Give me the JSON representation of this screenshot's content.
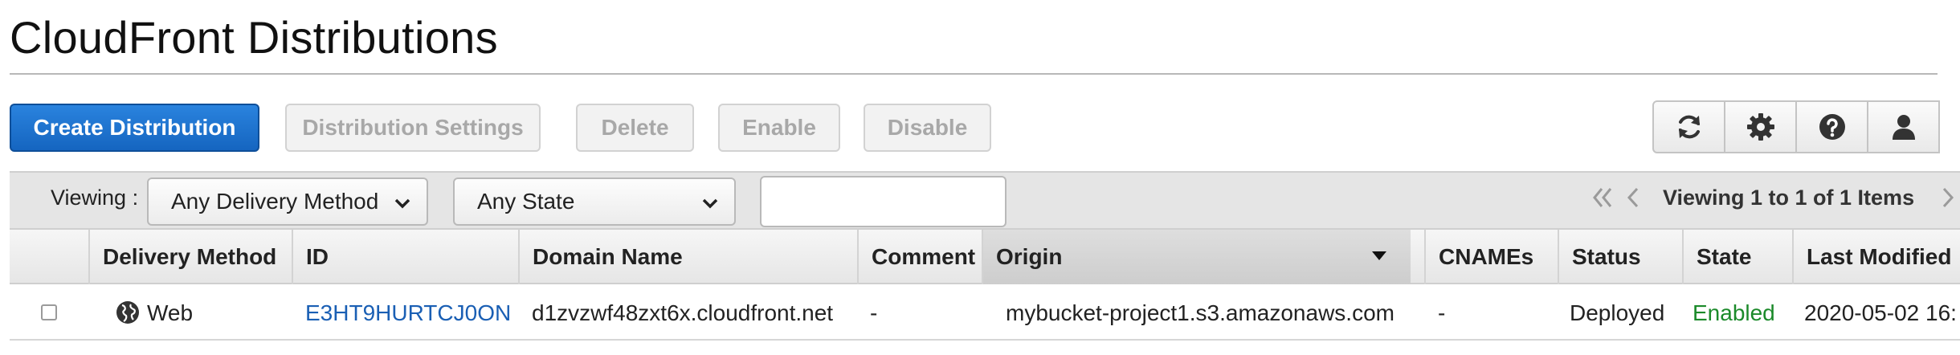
{
  "page": {
    "title": "CloudFront Distributions"
  },
  "actions": {
    "create": "Create Distribution",
    "settings": "Distribution Settings",
    "delete": "Delete",
    "enable": "Enable",
    "disable": "Disable"
  },
  "icons": [
    "refresh-icon",
    "gear-icon",
    "help-icon",
    "user-icon"
  ],
  "filters": {
    "viewing_label": "Viewing :",
    "delivery_method": "Any Delivery Method",
    "state": "Any State",
    "search_value": ""
  },
  "pager": {
    "text": "Viewing 1 to 1 of 1 Items"
  },
  "table": {
    "columns": [
      "Delivery Method",
      "ID",
      "Domain Name",
      "Comment",
      "Origin",
      "CNAMEs",
      "Status",
      "State",
      "Last Modified"
    ],
    "rows": [
      {
        "delivery_method": "Web",
        "id": "E3HT9HURTCJ0ON",
        "domain_name": "d1zvzwf48zxt6x.cloudfront.net",
        "comment": "-",
        "origin": "mybucket-project1.s3.amazonaws.com",
        "cnames": "-",
        "status": "Deployed",
        "state": "Enabled",
        "last_modified": "2020-05-02 16:"
      }
    ]
  },
  "colors": {
    "primary_button": "#1565c0",
    "link": "#1a5fb4",
    "enabled_state": "#1b8a2a"
  }
}
